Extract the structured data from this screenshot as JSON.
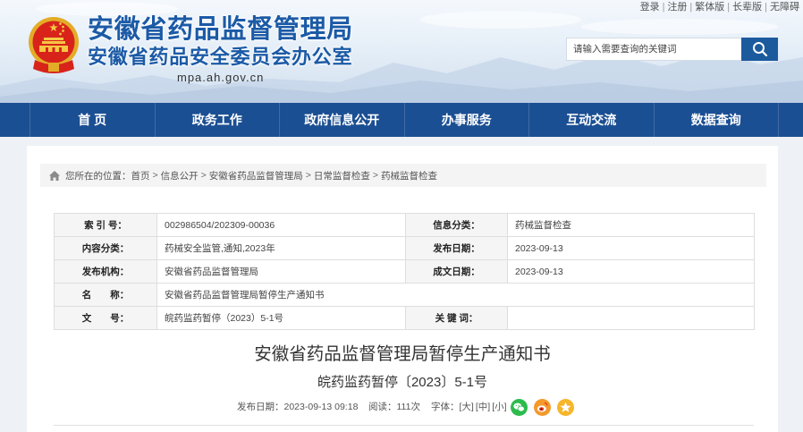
{
  "header": {
    "title": "安徽省药品监督管理局",
    "subtitle": "安徽省药品安全委员会办公室",
    "url": "mpa.ah.gov.cn"
  },
  "top_links": {
    "items": [
      "登录",
      "注册",
      "繁体版",
      "长辈版",
      "无障碍"
    ],
    "separator": "|"
  },
  "search": {
    "placeholder": "请输入需要查询的关键词"
  },
  "nav": [
    "首 页",
    "政务工作",
    "政府信息公开",
    "办事服务",
    "互动交流",
    "数据查询"
  ],
  "breadcrumb": {
    "prefix": "您所在的位置：",
    "items": [
      "首页",
      "信息公开",
      "安徽省药品监督管理局",
      "日常监督检查",
      "药械监督检查"
    ],
    "separator": ">"
  },
  "info_table": {
    "rows": [
      {
        "label1": "索 引 号：",
        "value1": "002986504/202309-00036",
        "label2": "信息分类：",
        "value2": "药械监督检查"
      },
      {
        "label1": "内容分类：",
        "value1": "药械安全监管,通知,2023年",
        "label2": "发布日期：",
        "value2": "2023-09-13"
      },
      {
        "label1": "发布机构：",
        "value1": "安徽省药品监督管理局",
        "label2": "成文日期：",
        "value2": "2023-09-13"
      },
      {
        "label1": "名　　称：",
        "value1": "安徽省药品监督管理局暂停生产通知书"
      },
      {
        "label1": "文　　号：",
        "value1": "皖药监药暂停（2023）5-1号",
        "label2": "关 键 词："
      }
    ]
  },
  "article": {
    "title": "安徽省药品监督管理局暂停生产通知书",
    "doc_number": "皖药监药暂停〔2023〕5-1号",
    "meta": {
      "publish": "发布日期：2023-09-13 09:18",
      "views": "阅读：111次",
      "font_label": "字体：",
      "font_sizes": [
        "[大]",
        "[中]",
        "[小]"
      ]
    }
  },
  "icons": {
    "emblem": "national-emblem-icon",
    "search": "search-icon",
    "home": "home-icon",
    "share": [
      "wechat-icon",
      "weibo-icon",
      "qzone-icon"
    ]
  },
  "colors": {
    "brand_blue": "#1b5aa6",
    "nav_bg": "#1b4f93",
    "search_button": "#1c5a9e",
    "wechat": "#2dbb4d",
    "weibo": "#f39a2b",
    "qzone": "#f6b52a"
  }
}
